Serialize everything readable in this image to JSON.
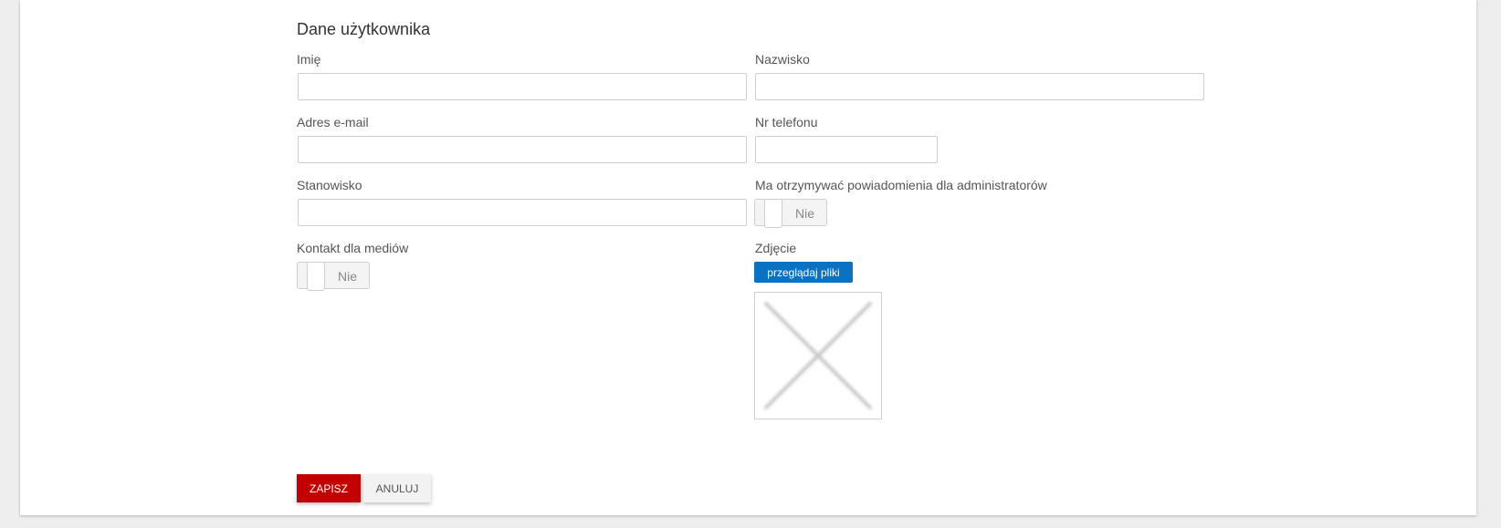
{
  "form": {
    "section_title": "Dane użytkownika",
    "first_name": {
      "label": "Imię",
      "value": ""
    },
    "last_name": {
      "label": "Nazwisko",
      "value": ""
    },
    "email": {
      "label": "Adres e-mail",
      "value": ""
    },
    "phone": {
      "label": "Nr telefonu",
      "value": ""
    },
    "position": {
      "label": "Stanowisko",
      "value": ""
    },
    "admin_notifications": {
      "label": "Ma otrzymywać powiadomienia dla administratorów",
      "state_text": "Nie"
    },
    "media_contact": {
      "label": "Kontakt dla mediów",
      "state_text": "Nie"
    },
    "photo": {
      "label": "Zdjęcie",
      "browse_label": "przeglądaj pliki",
      "placeholder_icon": "cross-icon"
    },
    "actions": {
      "save_label": "ZAPISZ",
      "cancel_label": "ANULUJ"
    }
  },
  "colors": {
    "primary_blue": "#0a72c2",
    "save_red": "#c30000",
    "background": "#eeeeee"
  }
}
